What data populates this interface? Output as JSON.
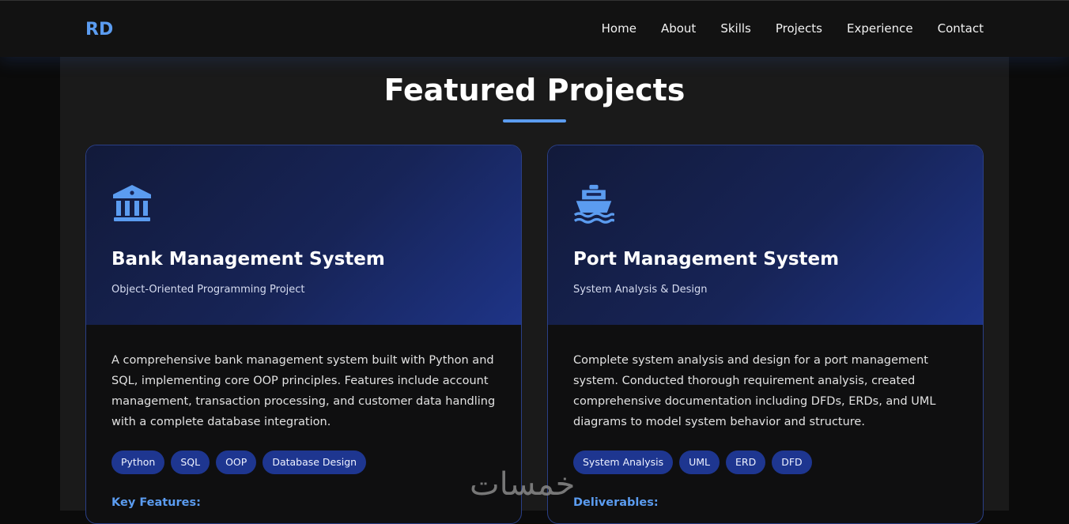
{
  "navbar": {
    "logo": "RD",
    "links": [
      "Home",
      "About",
      "Skills",
      "Projects",
      "Experience",
      "Contact"
    ]
  },
  "section": {
    "title": "Featured Projects"
  },
  "projects": [
    {
      "icon": "bank-icon",
      "title": "Bank Management System",
      "subtitle": "Object-Oriented Programming Project",
      "description": "A comprehensive bank management system built with Python and SQL, implementing core OOP principles. Features include account management, transaction processing, and customer data handling with a complete database integration.",
      "tags": [
        "Python",
        "SQL",
        "OOP",
        "Database Design"
      ],
      "subheading": "Key Features:"
    },
    {
      "icon": "ship-icon",
      "title": "Port Management System",
      "subtitle": "System Analysis & Design",
      "description": "Complete system analysis and design for a port management system. Conducted thorough requirement analysis, created comprehensive documentation including DFDs, ERDs, and UML diagrams to model system behavior and structure.",
      "tags": [
        "System Analysis",
        "UML",
        "ERD",
        "DFD"
      ],
      "subheading": "Deliverables:"
    }
  ],
  "watermark": "خمسات",
  "colors": {
    "accent": "#5b9cf0",
    "tag_bg": "#1e3690",
    "card_border": "#2a3f86",
    "page_bg": "#1a1a1a"
  }
}
